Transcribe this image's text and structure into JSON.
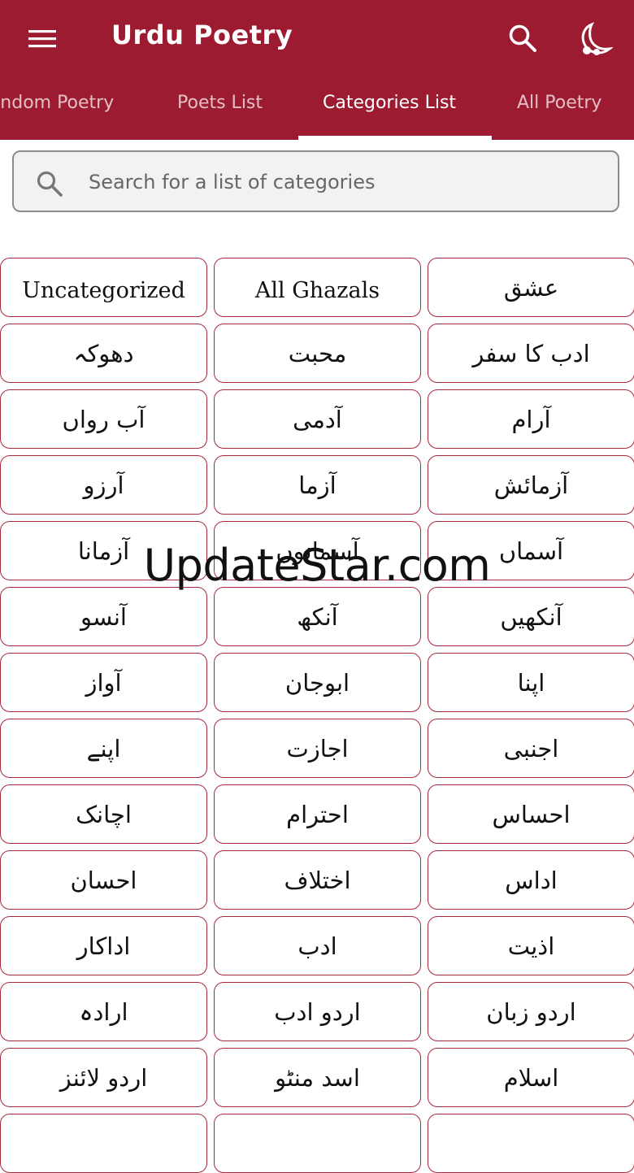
{
  "appbar": {
    "title": "Urdu Poetry",
    "color": "#9c1b31",
    "icons": [
      "menu-icon",
      "search-icon",
      "night-mode-icon"
    ]
  },
  "tabs": [
    {
      "label": "Random Poetry",
      "active": false
    },
    {
      "label": "Poets List",
      "active": false
    },
    {
      "label": "Categories List",
      "active": true
    },
    {
      "label": "All Poetry",
      "active": false
    }
  ],
  "search": {
    "placeholder": "Search for a list of categories",
    "value": ""
  },
  "categories": [
    "Uncategorized",
    "All Ghazals",
    "عشق",
    "دھوکہ",
    "محبت",
    "ادب کا سفر",
    "آب رواں",
    "آدمی",
    "آرام",
    "آرزو",
    "آزما",
    "آزمائش",
    "آزمانا",
    "آسمانوں",
    "آسماں",
    "آنسو",
    "آنکھ",
    "آنکھیں",
    "آواز",
    "ابوجان",
    "اپنا",
    "اپنے",
    "اجازت",
    "اجنبی",
    "اچانک",
    "احترام",
    "احساس",
    "احسان",
    "اختلاف",
    "اداس",
    "اداکار",
    "ادب",
    "اذیت",
    "ارادہ",
    "اردو ادب",
    "اردو زبان",
    "اردو لائنز",
    "اسد منٹو",
    "اسلام",
    "",
    "",
    ""
  ],
  "watermark": "UpdateStar.com"
}
